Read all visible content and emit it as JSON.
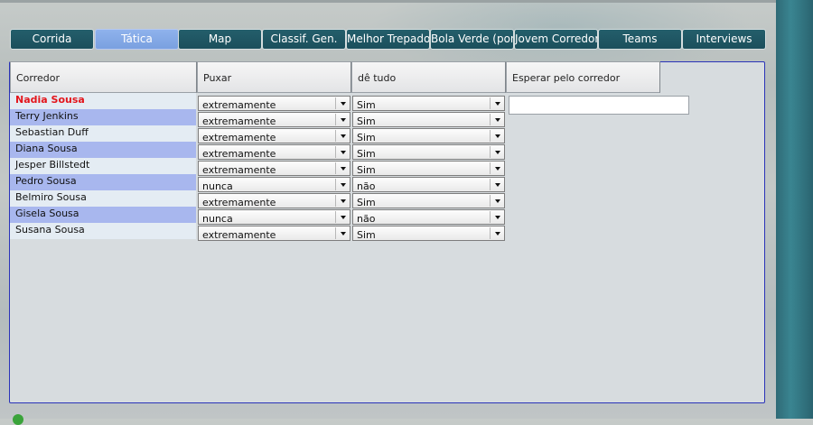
{
  "tabs": [
    {
      "label": "Corrida",
      "active": false
    },
    {
      "label": "Tática",
      "active": true
    },
    {
      "label": "Map",
      "active": false
    },
    {
      "label": "Classif. Gen.",
      "active": false
    },
    {
      "label": "Melhor Trepador",
      "active": false
    },
    {
      "label": "Bola Verde (pontos)",
      "active": false
    },
    {
      "label": "Jovem Corredor",
      "active": false
    },
    {
      "label": "Teams",
      "active": false
    },
    {
      "label": "Interviews",
      "active": false
    }
  ],
  "table": {
    "headers": {
      "rider": "Corredor",
      "pull": "Puxar",
      "give_all": "dê tudo",
      "wait": "Esperar pelo corredor"
    },
    "rows": [
      {
        "name": "Nadia Sousa",
        "pull": "extremamente",
        "give_all": "Sim",
        "highlight": true
      },
      {
        "name": "Terry Jenkins",
        "pull": "extremamente",
        "give_all": "Sim"
      },
      {
        "name": "Sebastian Duff",
        "pull": "extremamente",
        "give_all": "Sim"
      },
      {
        "name": "Diana Sousa",
        "pull": "extremamente",
        "give_all": "Sim"
      },
      {
        "name": "Jesper Billstedt",
        "pull": "extremamente",
        "give_all": "Sim"
      },
      {
        "name": "Pedro Sousa",
        "pull": "nunca",
        "give_all": "não"
      },
      {
        "name": "Belmiro Sousa",
        "pull": "extremamente",
        "give_all": "Sim"
      },
      {
        "name": "Gisela Sousa",
        "pull": "nunca",
        "give_all": "não"
      },
      {
        "name": "Susana Sousa",
        "pull": "extremamente",
        "give_all": "Sim"
      }
    ],
    "wait_value": ""
  },
  "colors": {
    "tab_bg": "#1f5664",
    "tab_active": "#86a9e8",
    "row_even": "#a8b7ee",
    "row_odd": "#e4ecf3",
    "highlight_name": "#e3161c",
    "panel_border": "#2a33b8"
  },
  "icons": {
    "dropdown": "chevron-down-icon"
  }
}
